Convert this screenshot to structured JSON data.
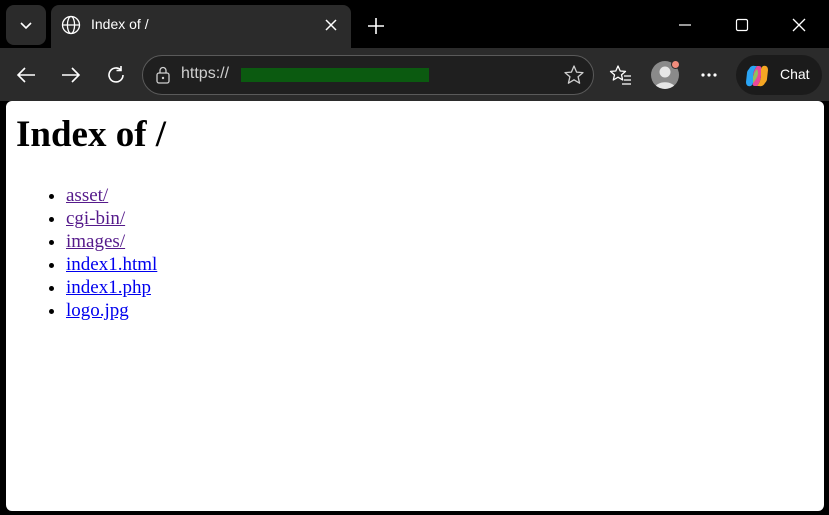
{
  "browser": {
    "tab_title": "Index of /",
    "url_prefix": "https://",
    "chat_label": "Chat",
    "accent_colors": {
      "redaction": "#0b5a10",
      "visited_link": "#551a8b",
      "link": "#0000ee"
    },
    "icons": [
      "tab-actions-chevron-icon",
      "globe-icon",
      "close-icon",
      "plus-icon",
      "minimize-icon",
      "maximize-icon",
      "window-close-icon",
      "back-arrow-icon",
      "forward-arrow-icon",
      "refresh-icon",
      "site-info-icon",
      "favorite-star-icon",
      "favorites-icon",
      "profile-icon",
      "more-icon",
      "copilot-icon"
    ]
  },
  "page": {
    "heading": "Index of /",
    "entries": [
      {
        "name": "asset/",
        "visited": true
      },
      {
        "name": "cgi-bin/",
        "visited": true
      },
      {
        "name": "images/",
        "visited": true
      },
      {
        "name": "index1.html",
        "visited": false
      },
      {
        "name": "index1.php",
        "visited": false
      },
      {
        "name": "logo.jpg",
        "visited": false
      }
    ]
  }
}
